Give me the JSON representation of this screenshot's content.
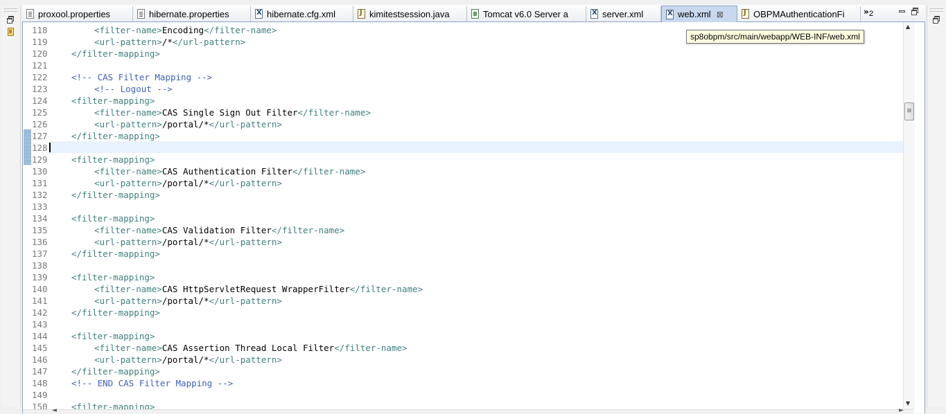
{
  "tabs": [
    {
      "label": "proxool.properties",
      "icon": "properties-file-icon"
    },
    {
      "label": "hibernate.properties",
      "icon": "properties-file-icon"
    },
    {
      "label": "hibernate.cfg.xml",
      "icon": "xml-file-icon"
    },
    {
      "label": "kimitestsession.java",
      "icon": "java-file-icon"
    },
    {
      "label": "Tomcat v6.0 Server a",
      "icon": "server-icon"
    },
    {
      "label": "server.xml",
      "icon": "xml-file-icon"
    },
    {
      "label": "web.xml",
      "icon": "xml-file-icon",
      "active": true,
      "close": "⊠"
    },
    {
      "label": "OBPMAuthenticationFi",
      "icon": "java-file-icon"
    }
  ],
  "overflow": {
    "chevron": "»",
    "count": "2"
  },
  "tooltip": "sp8obpm/src/main/webapp/WEB-INF/web.xml",
  "editor": {
    "current_line": "128",
    "lines": [
      {
        "n": "118",
        "indent": 2,
        "kind": "el",
        "open": "<filter-name>",
        "value": "Encoding",
        "close": "</filter-name>"
      },
      {
        "n": "119",
        "indent": 2,
        "kind": "el",
        "open": "<url-pattern>",
        "value": "/*",
        "close": "</url-pattern>"
      },
      {
        "n": "120",
        "indent": 1,
        "kind": "tag",
        "text": "</filter-mapping>"
      },
      {
        "n": "121",
        "indent": 0,
        "kind": "blank"
      },
      {
        "n": "122",
        "indent": 1,
        "kind": "comment",
        "text": "<!-- CAS Filter Mapping -->"
      },
      {
        "n": "123",
        "indent": 2,
        "kind": "comment",
        "text": "<!-- Logout -->"
      },
      {
        "n": "124",
        "indent": 1,
        "kind": "tag",
        "text": "<filter-mapping>"
      },
      {
        "n": "125",
        "indent": 2,
        "kind": "el",
        "open": "<filter-name>",
        "value": "CAS Single Sign Out Filter",
        "close": "</filter-name>"
      },
      {
        "n": "126",
        "indent": 2,
        "kind": "el",
        "open": "<url-pattern>",
        "value": "/portal/*",
        "close": "</url-pattern>"
      },
      {
        "n": "127",
        "indent": 1,
        "kind": "tag",
        "text": "</filter-mapping>"
      },
      {
        "n": "128",
        "indent": 0,
        "kind": "blank"
      },
      {
        "n": "129",
        "indent": 1,
        "kind": "tag",
        "text": "<filter-mapping>"
      },
      {
        "n": "130",
        "indent": 2,
        "kind": "el",
        "open": "<filter-name>",
        "value": "CAS Authentication Filter",
        "close": "</filter-name>"
      },
      {
        "n": "131",
        "indent": 2,
        "kind": "el",
        "open": "<url-pattern>",
        "value": "/portal/*",
        "close": "</url-pattern>"
      },
      {
        "n": "132",
        "indent": 1,
        "kind": "tag",
        "text": "</filter-mapping>"
      },
      {
        "n": "133",
        "indent": 0,
        "kind": "blank"
      },
      {
        "n": "134",
        "indent": 1,
        "kind": "tag",
        "text": "<filter-mapping>"
      },
      {
        "n": "135",
        "indent": 2,
        "kind": "el",
        "open": "<filter-name>",
        "value": "CAS Validation Filter",
        "close": "</filter-name>"
      },
      {
        "n": "136",
        "indent": 2,
        "kind": "el",
        "open": "<url-pattern>",
        "value": "/portal/*",
        "close": "</url-pattern>"
      },
      {
        "n": "137",
        "indent": 1,
        "kind": "tag",
        "text": "</filter-mapping>"
      },
      {
        "n": "138",
        "indent": 0,
        "kind": "blank"
      },
      {
        "n": "139",
        "indent": 1,
        "kind": "tag",
        "text": "<filter-mapping>"
      },
      {
        "n": "140",
        "indent": 2,
        "kind": "el",
        "open": "<filter-name>",
        "value": "CAS HttpServletRequest WrapperFilter",
        "close": "</filter-name>"
      },
      {
        "n": "141",
        "indent": 2,
        "kind": "el",
        "open": "<url-pattern>",
        "value": "/portal/*",
        "close": "</url-pattern>"
      },
      {
        "n": "142",
        "indent": 1,
        "kind": "tag",
        "text": "</filter-mapping>"
      },
      {
        "n": "143",
        "indent": 0,
        "kind": "blank"
      },
      {
        "n": "144",
        "indent": 1,
        "kind": "tag",
        "text": "<filter-mapping>"
      },
      {
        "n": "145",
        "indent": 2,
        "kind": "el",
        "open": "<filter-name>",
        "value": "CAS Assertion Thread Local Filter",
        "close": "</filter-name>"
      },
      {
        "n": "146",
        "indent": 2,
        "kind": "el",
        "open": "<url-pattern>",
        "value": "/portal/*",
        "close": "</url-pattern>"
      },
      {
        "n": "147",
        "indent": 1,
        "kind": "tag",
        "text": "</filter-mapping>"
      },
      {
        "n": "148",
        "indent": 1,
        "kind": "comment",
        "text": "<!-- END CAS Filter Mapping -->"
      },
      {
        "n": "149",
        "indent": 0,
        "kind": "blank"
      },
      {
        "n": "150",
        "indent": 1,
        "kind": "tag",
        "text": "<filter-mapping>"
      }
    ]
  },
  "colors": {
    "tag": "#3f7f7f",
    "comment": "#3f5fbf",
    "current_line_bg": "#e8f2fe",
    "active_tab_bg": "#c8d8ee"
  }
}
